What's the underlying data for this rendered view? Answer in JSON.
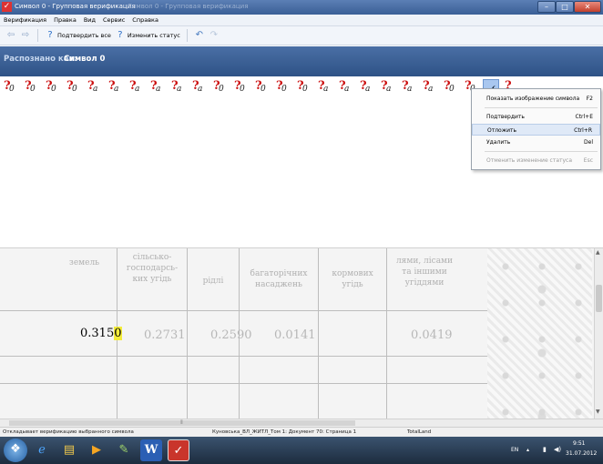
{
  "window": {
    "title": "Символ 0 - Групповая верификация",
    "title_dim": "Символ 0 - Групповая верификация"
  },
  "menu": [
    "Верификация",
    "Правка",
    "Вид",
    "Сервис",
    "Справка"
  ],
  "toolbar": {
    "confirm_all": "Подтвердить все",
    "change_status": "Изменить статус"
  },
  "banner": {
    "label": "Распознано как:",
    "value": "Символ 0"
  },
  "symbols": {
    "marker": "?",
    "glyphs": [
      "0",
      "0",
      "0",
      "0",
      "a",
      "a",
      "a",
      "a",
      "a",
      "a",
      "0",
      "0",
      "0",
      "0",
      "0",
      "a",
      "a",
      "a",
      "a",
      "a",
      "a",
      "0",
      "0"
    ],
    "selected_glyph": "("
  },
  "context_menu": {
    "items": [
      {
        "label": "Показать изображение символа",
        "shortcut": "F2"
      },
      {
        "label": "Подтвердить",
        "shortcut": "Ctrl+E"
      },
      {
        "label": "Отложить",
        "shortcut": "Ctrl+R"
      },
      {
        "label": "Удалить",
        "shortcut": "Del"
      },
      {
        "label": "Отменить изменение статуса",
        "shortcut": "Esc"
      }
    ]
  },
  "image": {
    "headers": [
      "земель",
      "сільсько-\nгосподарсь-\nких угідь",
      "рідлі",
      "багаторічних\nнасаджень",
      "кормових\nугідь",
      "лями, лісами\nта іншими\nугіддями"
    ],
    "values": [
      "0.315",
      "0",
      "0.2731",
      "0.2590",
      "0.0141",
      "0.0419"
    ]
  },
  "statusbar": {
    "hint": "Откладывает верификацию выбранного символа",
    "document": "Куновська_ВЛ_ЖИТЛ_Том 1: Документ 70: Страница 1",
    "project": "TotalLand"
  },
  "taskbar": {
    "lang": "EN",
    "time": "9:51",
    "date": "31.07.2012"
  }
}
